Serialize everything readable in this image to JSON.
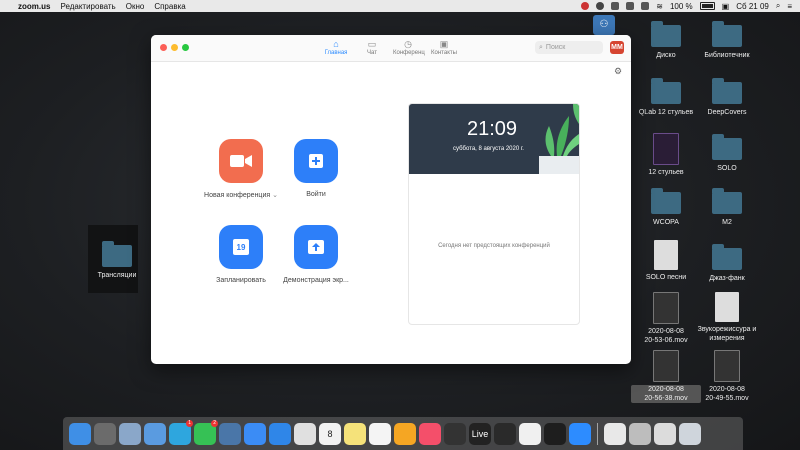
{
  "menubar": {
    "app": "zoom.us",
    "items": [
      "Редактировать",
      "Окно",
      "Справка"
    ],
    "battery": "100 %",
    "clock": "Сб 21 09"
  },
  "desktop": {
    "left_icons": [
      {
        "label": "Трансляции"
      }
    ],
    "right_icons": [
      {
        "label": "Диско"
      },
      {
        "label": "Библиотечник"
      },
      {
        "label": "QLab 12 стульев"
      },
      {
        "label": "DeepCovers"
      },
      {
        "label": "12 стульев"
      },
      {
        "label": "SOLO"
      },
      {
        "label": "WCOPA"
      },
      {
        "label": "M2"
      },
      {
        "label": "SOLO песни"
      },
      {
        "label": "Джаз-фанк"
      },
      {
        "label": "2020-08-08\n20-53-06.mov"
      },
      {
        "label": "Звукорежиссура и измерения"
      },
      {
        "label": "2020-08-08\n20-56-38.mov"
      },
      {
        "label": "2020-08-08\n20-49-55.mov"
      }
    ]
  },
  "zoom": {
    "tabs": [
      {
        "label": "Главная",
        "icon": "home-icon",
        "active": true
      },
      {
        "label": "Чат",
        "icon": "chat-icon",
        "active": false
      },
      {
        "label": "Конференц",
        "icon": "clock-icon",
        "active": false
      },
      {
        "label": "Контакты",
        "icon": "contacts-icon",
        "active": false
      }
    ],
    "search_placeholder": "Поиск",
    "avatar_initials": "MM",
    "actions": {
      "new_meeting": "Новая конференция",
      "join": "Войти",
      "schedule": "Запланировать",
      "schedule_day": "19",
      "share": "Демонстрация экр..."
    },
    "card": {
      "time": "21:09",
      "date": "суббота, 8 августа 2020 г.",
      "empty": "Сегодня нет предстоящих конференций"
    },
    "colors": {
      "accent": "#2d7ff9",
      "orange": "#f26d4f",
      "avatar": "#d64531"
    }
  },
  "dock": {
    "apps": [
      {
        "name": "finder-icon",
        "color": "#3f8fe6"
      },
      {
        "name": "launchpad-icon",
        "color": "#6b6b6b"
      },
      {
        "name": "preview-icon",
        "color": "#8aa7c9"
      },
      {
        "name": "chat-bubble-icon",
        "color": "#5a9be0"
      },
      {
        "name": "telegram-icon",
        "color": "#2ea6de",
        "badge": "1"
      },
      {
        "name": "whatsapp-icon",
        "color": "#36c155",
        "badge": "2"
      },
      {
        "name": "vk-icon",
        "color": "#4a76a8"
      },
      {
        "name": "messenger-icon",
        "color": "#3b8cf5"
      },
      {
        "name": "safari-icon",
        "color": "#2f86e8"
      },
      {
        "name": "chrome-icon",
        "color": "#e0e0e0"
      },
      {
        "name": "calendar-icon",
        "color": "#f2f2f2",
        "text": "8"
      },
      {
        "name": "notes-icon",
        "color": "#f5e27a"
      },
      {
        "name": "reminders-icon",
        "color": "#f4f4f4"
      },
      {
        "name": "pages-icon",
        "color": "#f5a623"
      },
      {
        "name": "music-icon",
        "color": "#f44f6a"
      },
      {
        "name": "logic-icon",
        "color": "#333333"
      },
      {
        "name": "ableton-live-icon",
        "color": "#222222",
        "text": "Live"
      },
      {
        "name": "final-cut-icon",
        "color": "#2a2a2a"
      },
      {
        "name": "photos-icon",
        "color": "#f0f0f0"
      },
      {
        "name": "obs-icon",
        "color": "#1e1e1e"
      },
      {
        "name": "zoom-icon",
        "color": "#2d8cff"
      }
    ],
    "right": [
      {
        "name": "document-icon",
        "color": "#e8e8e8"
      },
      {
        "name": "folder-stack-icon",
        "color": "#bdbdbd"
      },
      {
        "name": "screenshot-icon",
        "color": "#dcdcdc"
      },
      {
        "name": "trash-icon",
        "color": "#cfd5dc"
      }
    ]
  }
}
